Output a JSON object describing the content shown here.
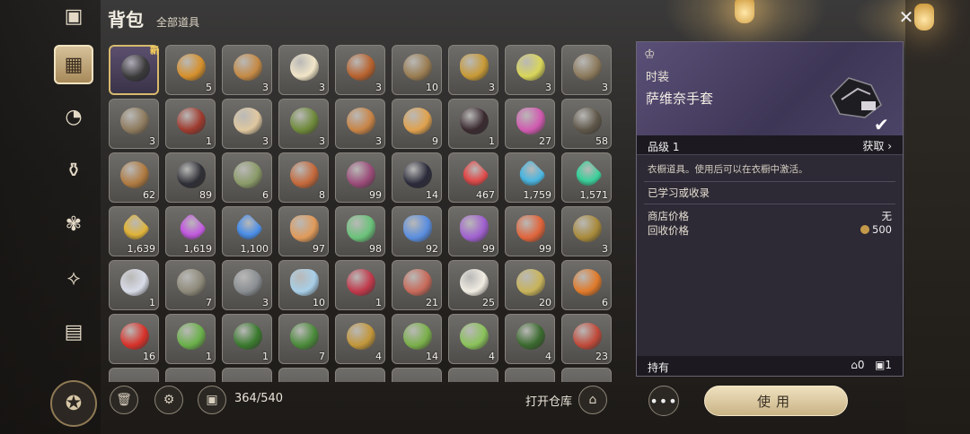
{
  "header": {
    "title": "背包",
    "subtitle": "全部道具"
  },
  "nav": {
    "items": [
      {
        "name": "chest-icon",
        "glyph": "▣"
      },
      {
        "name": "grid-icon",
        "glyph": "▦",
        "active": true
      },
      {
        "name": "pouch-icon",
        "glyph": "◔"
      },
      {
        "name": "potion-icon",
        "glyph": "⚱"
      },
      {
        "name": "herb-icon",
        "glyph": "✾"
      },
      {
        "name": "fish-icon",
        "glyph": "⟡"
      },
      {
        "name": "card-icon",
        "glyph": "▤"
      }
    ]
  },
  "grid": {
    "new_label": "新",
    "items": [
      {
        "name": "glove",
        "qty": "",
        "color": "#3a3a3a",
        "new": true
      },
      {
        "name": "fried-rice",
        "qty": "5",
        "color": "#d6902c"
      },
      {
        "name": "bread-roll",
        "qty": "3",
        "color": "#c58a45"
      },
      {
        "name": "fried-egg",
        "qty": "3",
        "color": "#f2e6c8"
      },
      {
        "name": "pie",
        "qty": "3",
        "color": "#b8622e"
      },
      {
        "name": "sack",
        "qty": "10",
        "color": "#9a7d52"
      },
      {
        "name": "oil-jar",
        "qty": "3",
        "color": "#c89a36"
      },
      {
        "name": "juice-glass",
        "qty": "3",
        "color": "#d9d65a"
      },
      {
        "name": "fish",
        "qty": "3",
        "color": "#8c7a5c"
      },
      {
        "name": "fish-small",
        "qty": "3",
        "color": "#8e7b5e"
      },
      {
        "name": "steak",
        "qty": "1",
        "color": "#9e3a2e"
      },
      {
        "name": "plate-meal",
        "qty": "3",
        "color": "#e0c8a0"
      },
      {
        "name": "cabbage-dish",
        "qty": "3",
        "color": "#6e8a3a"
      },
      {
        "name": "muffin",
        "qty": "3",
        "color": "#c88446"
      },
      {
        "name": "cheese",
        "qty": "9",
        "color": "#e0a24e"
      },
      {
        "name": "berries",
        "qty": "1",
        "color": "#3a2a30"
      },
      {
        "name": "pink-potion",
        "qty": "27",
        "color": "#d05ab0"
      },
      {
        "name": "eel",
        "qty": "58",
        "color": "#5e5648"
      },
      {
        "name": "seed-ball",
        "qty": "62",
        "color": "#b07a40"
      },
      {
        "name": "dark-worm",
        "qty": "89",
        "color": "#2e2e36"
      },
      {
        "name": "moss-ball",
        "qty": "6",
        "color": "#8a9a68"
      },
      {
        "name": "worm",
        "qty": "8",
        "color": "#c4683a"
      },
      {
        "name": "purple-pod",
        "qty": "99",
        "color": "#9a4a78"
      },
      {
        "name": "beetle",
        "qty": "14",
        "color": "#2a2a3a"
      },
      {
        "name": "red-crystal",
        "qty": "467",
        "color": "#e04a4a"
      },
      {
        "name": "blue-crystal",
        "qty": "1,759",
        "color": "#4ab6e0"
      },
      {
        "name": "green-crystal",
        "qty": "1,571",
        "color": "#3ad09a"
      },
      {
        "name": "yellow-crystal",
        "qty": "1,639",
        "color": "#e0b43a"
      },
      {
        "name": "violet-crystal",
        "qty": "1,619",
        "color": "#c25ae0"
      },
      {
        "name": "azure-crystal",
        "qty": "1,100",
        "color": "#4a8ee8"
      },
      {
        "name": "orange-flask",
        "qty": "97",
        "color": "#e09a5a"
      },
      {
        "name": "green-flask",
        "qty": "98",
        "color": "#6ac27a"
      },
      {
        "name": "blue-flask",
        "qty": "92",
        "color": "#5a8ee0"
      },
      {
        "name": "purple-flask",
        "qty": "99",
        "color": "#a060d0"
      },
      {
        "name": "red-flask",
        "qty": "99",
        "color": "#e0643a"
      },
      {
        "name": "leaf",
        "qty": "3",
        "color": "#a88a3a"
      },
      {
        "name": "jellyfish",
        "qty": "1",
        "color": "#d8dce8"
      },
      {
        "name": "pike-fish",
        "qty": "7",
        "color": "#8e8a7a"
      },
      {
        "name": "river-fish",
        "qty": "3",
        "color": "#8a8e92"
      },
      {
        "name": "milk-bottle",
        "qty": "10",
        "color": "#a8cfe8"
      },
      {
        "name": "jam-dish",
        "qty": "1",
        "color": "#c0384a"
      },
      {
        "name": "ham",
        "qty": "21",
        "color": "#c86a5a"
      },
      {
        "name": "egg",
        "qty": "25",
        "color": "#f0ece2"
      },
      {
        "name": "green-egg",
        "qty": "20",
        "color": "#c8b45a"
      },
      {
        "name": "pumpkin",
        "qty": "6",
        "color": "#e07a2a"
      },
      {
        "name": "tomato",
        "qty": "16",
        "color": "#d8322a"
      },
      {
        "name": "lettuce",
        "qty": "1",
        "color": "#6ab04a"
      },
      {
        "name": "broccoli",
        "qty": "1",
        "color": "#3a7a2e"
      },
      {
        "name": "spinach",
        "qty": "7",
        "color": "#4a8a3a"
      },
      {
        "name": "potato",
        "qty": "4",
        "color": "#c2963a"
      },
      {
        "name": "pea-pod",
        "qty": "14",
        "color": "#7ab04a"
      },
      {
        "name": "leek",
        "qty": "4",
        "color": "#8ac25a"
      },
      {
        "name": "zucchini",
        "qty": "4",
        "color": "#3a6a2e"
      },
      {
        "name": "mushroom",
        "qty": "23",
        "color": "#c04a3a"
      }
    ]
  },
  "bottom": {
    "capacity": "364/540",
    "open_warehouse": "打开仓库"
  },
  "detail": {
    "category": "时装",
    "name": "萨维奈手套",
    "grade": "品级 1",
    "obtain": "获取",
    "description": "衣橱道具。使用后可以在衣橱中激活。",
    "learned": "已学习或收录",
    "shop_price_label": "商店价格",
    "shop_price_value": "无",
    "recycle_price_label": "回收价格",
    "recycle_price_value": "500",
    "hold_label": "持有",
    "hold_warehouse": "0",
    "hold_bag": "1"
  },
  "actions": {
    "more": "•••",
    "use": "使用"
  }
}
